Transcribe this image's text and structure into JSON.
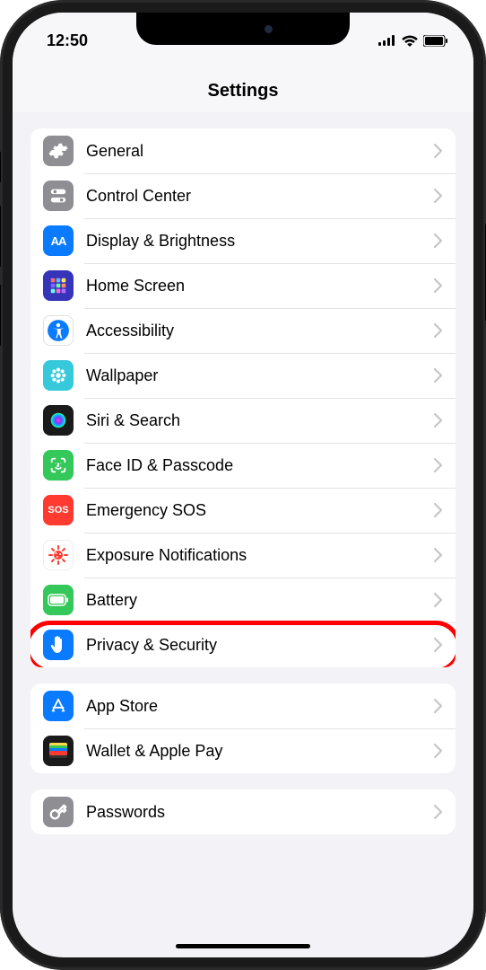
{
  "status": {
    "time": "12:50"
  },
  "header": {
    "title": "Settings"
  },
  "groups": [
    {
      "items": [
        {
          "key": "general",
          "label": "General",
          "icon": "gear",
          "bg": "#8e8e93"
        },
        {
          "key": "control-center",
          "label": "Control Center",
          "icon": "switches",
          "bg": "#8e8e93"
        },
        {
          "key": "display",
          "label": "Display & Brightness",
          "icon": "aa",
          "bg": "#0a7aff"
        },
        {
          "key": "home-screen",
          "label": "Home Screen",
          "icon": "grid",
          "bg": "#3b3bce"
        },
        {
          "key": "accessibility",
          "label": "Accessibility",
          "icon": "accessibility",
          "bg": "#ffffff"
        },
        {
          "key": "wallpaper",
          "label": "Wallpaper",
          "icon": "flower",
          "bg": "#3dd0e0"
        },
        {
          "key": "siri",
          "label": "Siri & Search",
          "icon": "siri",
          "bg": "#1a1a1a"
        },
        {
          "key": "faceid",
          "label": "Face ID & Passcode",
          "icon": "face",
          "bg": "#34c759"
        },
        {
          "key": "sos",
          "label": "Emergency SOS",
          "icon": "sos",
          "bg": "#ff3a30"
        },
        {
          "key": "exposure",
          "label": "Exposure Notifications",
          "icon": "covid",
          "bg": "#ffffff"
        },
        {
          "key": "battery",
          "label": "Battery",
          "icon": "battery",
          "bg": "#34c759"
        },
        {
          "key": "privacy",
          "label": "Privacy & Security",
          "icon": "hand",
          "bg": "#0a7aff",
          "highlighted": true
        }
      ]
    },
    {
      "items": [
        {
          "key": "appstore",
          "label": "App Store",
          "icon": "appstore",
          "bg": "#0a7aff"
        },
        {
          "key": "wallet",
          "label": "Wallet & Apple Pay",
          "icon": "wallet",
          "bg": "#1a1a1a"
        }
      ]
    },
    {
      "items": [
        {
          "key": "passwords",
          "label": "Passwords",
          "icon": "key",
          "bg": "#8e8e93"
        }
      ]
    }
  ]
}
